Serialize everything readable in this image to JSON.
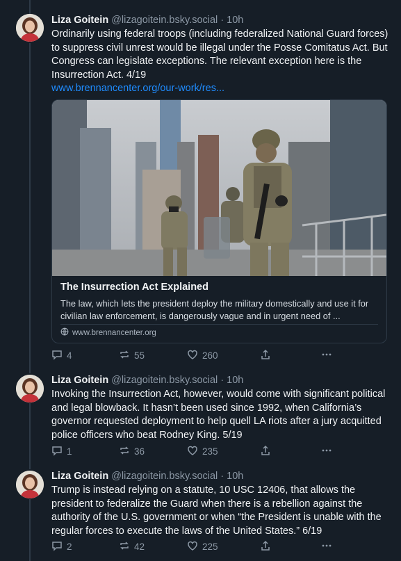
{
  "posts": [
    {
      "author": "Liza Goitein",
      "handle": "@lizagoitein.bsky.social",
      "separator": " · ",
      "time": "10h",
      "text": "Ordinarily using federal troops (including federalized National Guard forces) to suppress civil unrest would be illegal under the Posse Comitatus Act. But Congress can legislate exceptions. The relevant exception here is the Insurrection Act. 4/19",
      "link": "www.brennancenter.org/our-work/res...",
      "card": {
        "title": "The Insurrection Act Explained",
        "description": "The law, which lets the president deploy the military domestically and use it for civilian law enforcement, is dangerously vague and in urgent need of ...",
        "domain": "www.brennancenter.org"
      },
      "replies": "4",
      "reposts": "55",
      "likes": "260"
    },
    {
      "author": "Liza Goitein",
      "handle": "@lizagoitein.bsky.social",
      "separator": " · ",
      "time": "10h",
      "text": "Invoking the Insurrection Act, however, would come with significant political and legal blowback. It hasn’t been used since 1992, when California’s governor requested deployment to help quell LA riots after a jury acquitted police officers who beat Rodney King. 5/19",
      "replies": "1",
      "reposts": "36",
      "likes": "235"
    },
    {
      "author": "Liza Goitein",
      "handle": "@lizagoitein.bsky.social",
      "separator": " · ",
      "time": "10h",
      "text": "Trump is instead relying on a statute, 10 USC 12406, that allows the president to federalize the Guard when there is a rebellion against the authority of the U.S. government or when “the President is unable with the regular forces to execute the laws of the United States.” 6/19",
      "replies": "2",
      "reposts": "42",
      "likes": "225"
    }
  ],
  "icons": [
    "reply-icon",
    "repost-icon",
    "like-icon",
    "share-icon",
    "more-icon",
    "globe-icon"
  ],
  "colors": {
    "background": "#161e27",
    "link": "#1f8cff",
    "muted": "#8d99a6",
    "border": "#2e3a47"
  }
}
